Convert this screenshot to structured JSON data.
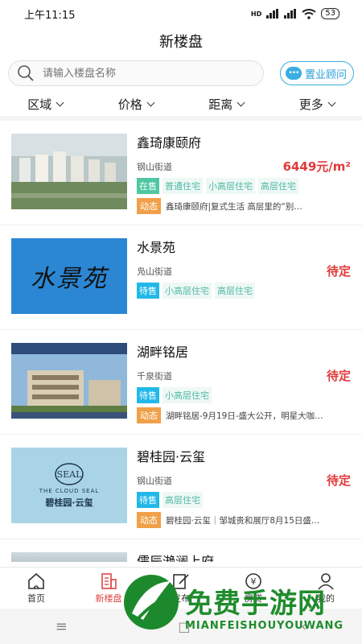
{
  "status": {
    "time": "上午11:15",
    "signal1": "HD",
    "battery": "53"
  },
  "header": {
    "title": "新楼盘"
  },
  "search": {
    "placeholder": "请输入楼盘名称",
    "consult_label": "置业顾问"
  },
  "filters": [
    "区域",
    "价格",
    "距离",
    "更多"
  ],
  "listings": [
    {
      "name": "鑫琦康颐府",
      "street": "钢山街道",
      "price": "6449元/m²",
      "status": "在售",
      "tags": [
        "普通住宅",
        "小高层住宅",
        "高层住宅"
      ],
      "news_badge": "动态",
      "news": "鑫琦康颐府|复式生活 高层里的“别…"
    },
    {
      "name": "水景苑",
      "street": "凫山街道",
      "price": "待定",
      "status": "待售",
      "tags": [
        "小高层住宅",
        "高层住宅"
      ],
      "thumb_text": "水景苑"
    },
    {
      "name": "湖畔铭居",
      "street": "千泉街道",
      "price": "待定",
      "status": "待售",
      "tags": [
        "小高层住宅"
      ],
      "news_badge": "动态",
      "news": "湖畔铭居-9月19日-盛大公开，明星大咖…"
    },
    {
      "name": "碧桂园·云玺",
      "street": "钢山街道",
      "price": "待定",
      "status": "待售",
      "tags": [
        "高层住宅"
      ],
      "news_badge": "动态",
      "news": "碧桂园·云玺｜邹城贵和展厅8月15日盛…",
      "thumb_text_en": "THE CLOUD SEAL",
      "thumb_text_cn": "碧桂园·云玺"
    },
    {
      "name": "儒辰滟澜上府"
    }
  ],
  "tabs": [
    {
      "label": "首页",
      "icon": "home-icon"
    },
    {
      "label": "新楼盘",
      "icon": "building-icon"
    },
    {
      "label": "发布",
      "icon": "edit-icon"
    },
    {
      "label": "房贷",
      "icon": "yen-icon"
    },
    {
      "label": "我的",
      "icon": "user-icon"
    }
  ],
  "watermark": {
    "cn": "免费手游网",
    "en": "MIANFEISHOUYOUWANG"
  },
  "colors": {
    "accent": "#2a9fd8",
    "price": "#e03a3a",
    "active_tab": "#e04646",
    "news_badge": "#f0a04a"
  }
}
